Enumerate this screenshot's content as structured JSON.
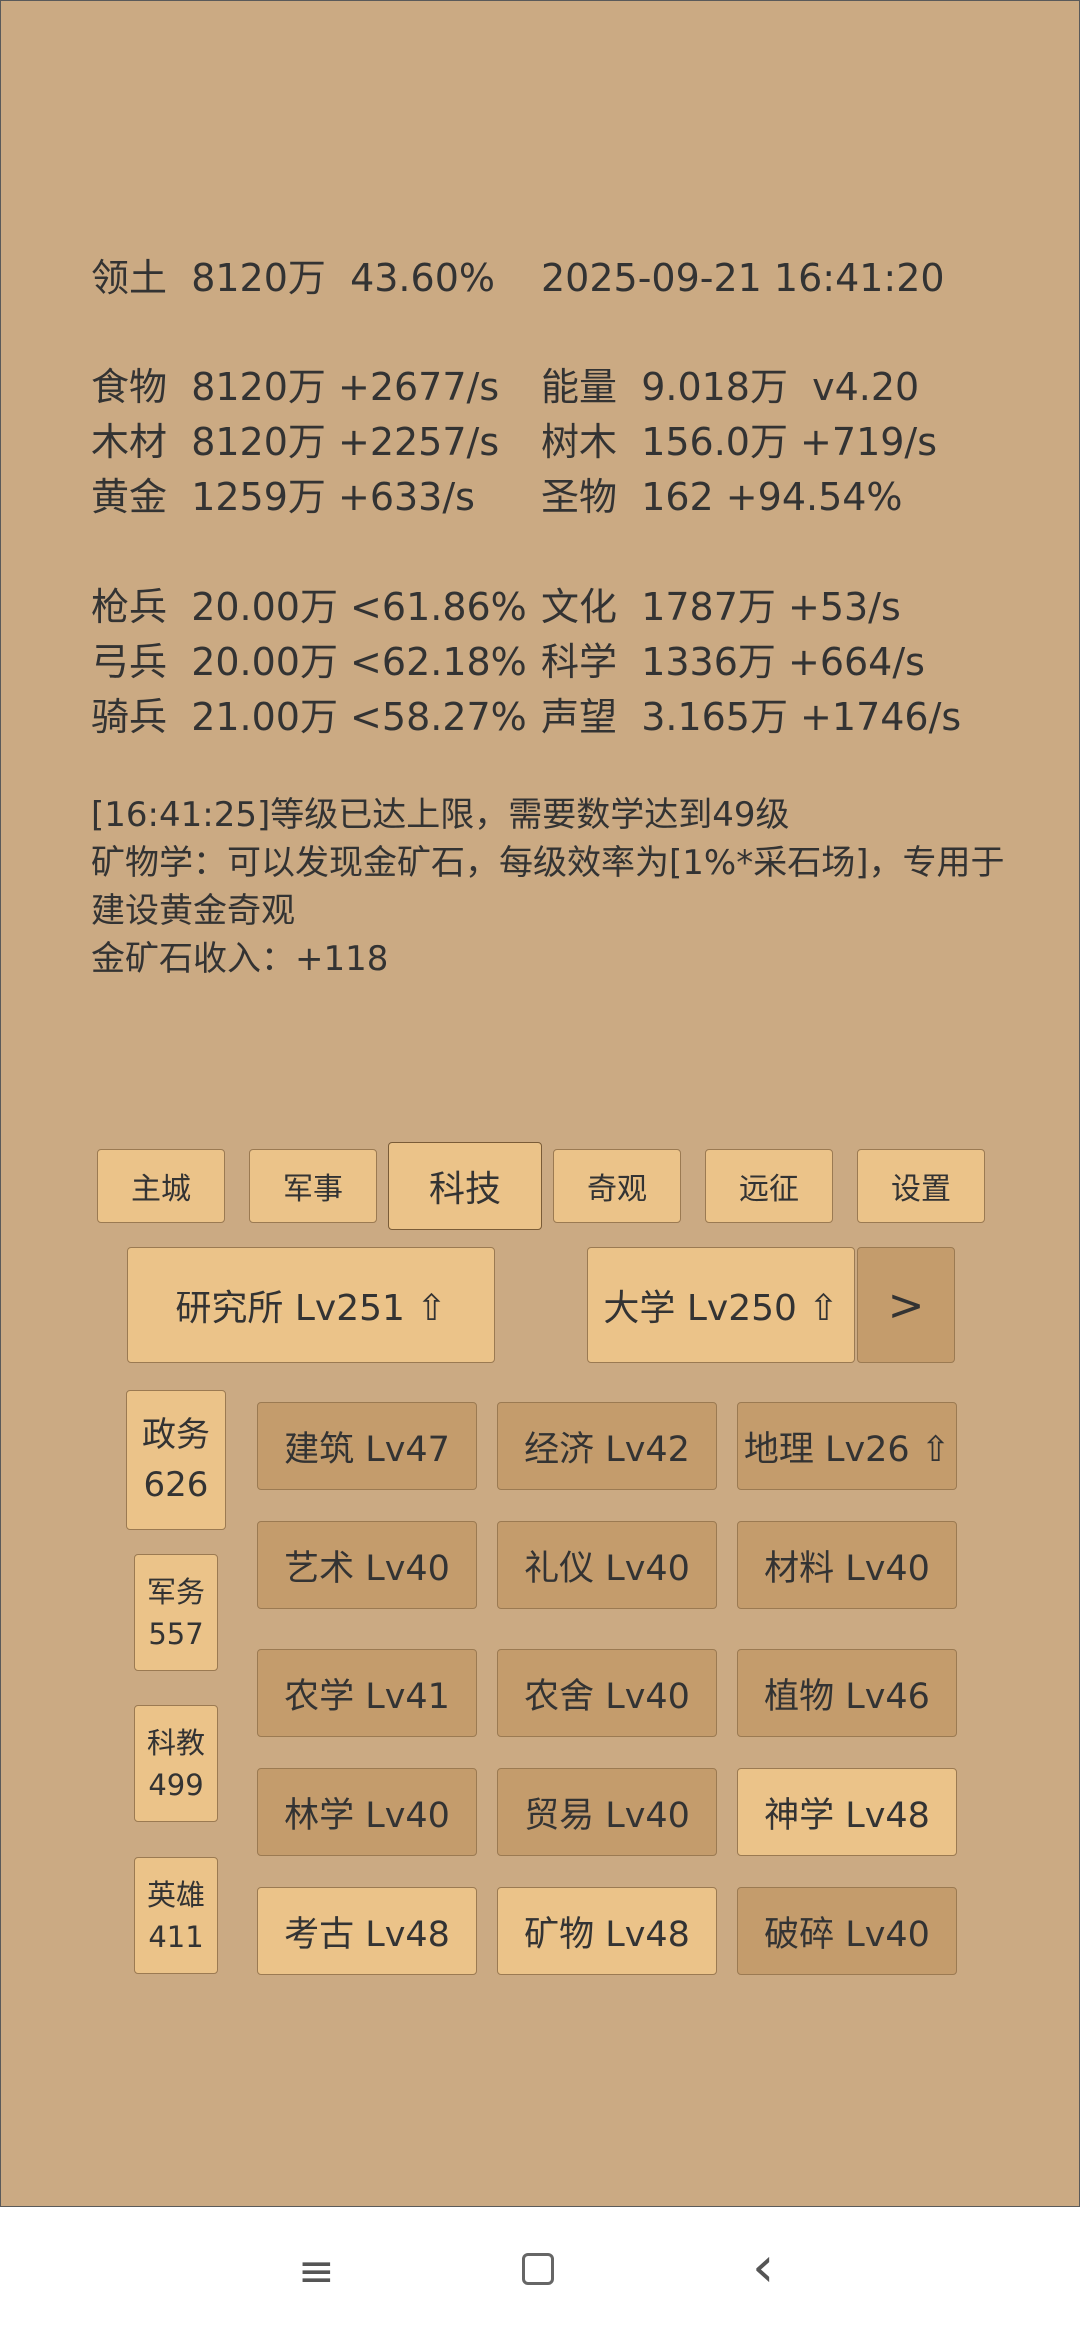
{
  "header": {
    "territory_label": "领土",
    "territory_value": "8120万",
    "territory_pct": "43.60%",
    "datetime": "2025-09-21 16:41:20"
  },
  "resources": [
    {
      "label": "食物",
      "value": "8120万 +2677/s"
    },
    {
      "label": "木材",
      "value": "8120万 +2257/s"
    },
    {
      "label": "黄金",
      "value": "1259万 +633/s"
    },
    {
      "label": "能量",
      "value": "9.018万  v4.20"
    },
    {
      "label": "树木",
      "value": "156.0万 +719/s"
    },
    {
      "label": "圣物",
      "value": "162 +94.54%"
    }
  ],
  "troops": [
    {
      "label": "枪兵",
      "value": "20.00万 <61.86%"
    },
    {
      "label": "弓兵",
      "value": "20.00万 <62.18%"
    },
    {
      "label": "骑兵",
      "value": "21.00万 <58.27%"
    },
    {
      "label": "文化",
      "value": "1787万 +53/s"
    },
    {
      "label": "科学",
      "value": "1336万 +664/s"
    },
    {
      "label": "声望",
      "value": "3.165万 +1746/s"
    }
  ],
  "messages": [
    "[16:41:25]等级已达上限，需要数学达到49级",
    "矿物学：可以发现金矿石，每级效率为[1%*采石场]，专用于建设黄金奇观",
    "金矿石收入：+118"
  ],
  "tabs": [
    "主城",
    "军事",
    "科技",
    "奇观",
    "远征",
    "设置"
  ],
  "buildings": {
    "institute": "研究所 Lv251 ⇧",
    "university": "大学 Lv250 ⇧",
    "next": ">"
  },
  "categories": [
    {
      "name": "政务",
      "value": "626"
    },
    {
      "name": "军务",
      "value": "557"
    },
    {
      "name": "科教",
      "value": "499"
    },
    {
      "name": "英雄",
      "value": "411"
    }
  ],
  "techs": [
    "建筑 Lv47",
    "经济 Lv42",
    "地理 Lv26 ⇧",
    "艺术 Lv40",
    "礼仪 Lv40",
    "材料 Lv40",
    "农学 Lv41",
    "农舍 Lv40",
    "植物 Lv46",
    "林学 Lv40",
    "贸易 Lv40",
    "神学 Lv48",
    "考古 Lv48",
    "矿物 Lv48",
    "破碎 Lv40"
  ],
  "navbar": {
    "menu": "≡",
    "home": "▢",
    "back": "‹"
  },
  "colors": {
    "background": "#cbaa83",
    "button_light": "#ebc389",
    "button_dark": "#c49c6c"
  }
}
